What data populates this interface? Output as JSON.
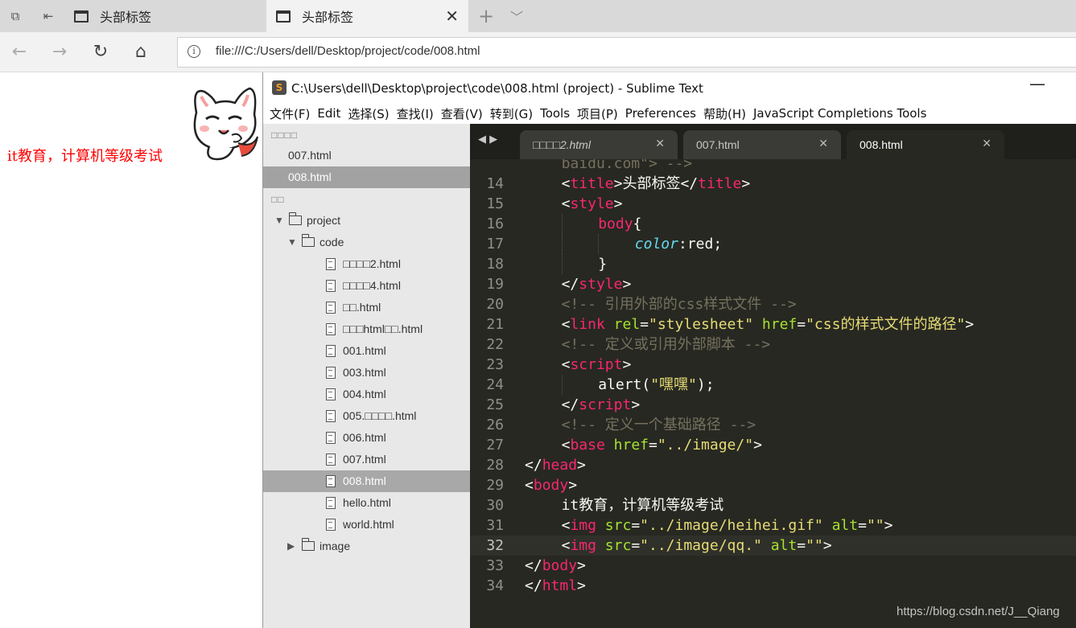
{
  "browser": {
    "tabs": [
      {
        "title": "头部标签",
        "active": false
      },
      {
        "title": "头部标签",
        "active": true
      }
    ],
    "new_tab_icon": "plus-icon",
    "address": "file:///C:/Users/dell/Desktop/project/code/008.html"
  },
  "page": {
    "text": "it教育，计算机等级考试",
    "text_color": "#ff0000",
    "image": "cartoon-cat"
  },
  "sublime": {
    "title": "C:\\Users\\dell\\Desktop\\project\\code\\008.html (project) - Sublime Text",
    "menu": [
      "文件(F)",
      "Edit",
      "选择(S)",
      "查找(I)",
      "查看(V)",
      "转到(G)",
      "Tools",
      "项目(P)",
      "Preferences",
      "帮助(H)",
      "JavaScript Completions Tools"
    ],
    "sidebar": {
      "open_files_header": "□□□□",
      "open_files": [
        "007.html",
        "008.html"
      ],
      "folders_header": "□□",
      "tree": [
        {
          "label": "project",
          "type": "folder",
          "expanded": true,
          "depth": 0
        },
        {
          "label": "code",
          "type": "folder",
          "expanded": true,
          "depth": 1
        },
        {
          "label": "□□□□2.html",
          "type": "file",
          "depth": 2
        },
        {
          "label": "□□□□4.html",
          "type": "file",
          "depth": 2
        },
        {
          "label": "□□.html",
          "type": "file",
          "depth": 2
        },
        {
          "label": "□□□html□□.html",
          "type": "file",
          "depth": 2
        },
        {
          "label": "001.html",
          "type": "file",
          "depth": 2
        },
        {
          "label": "003.html",
          "type": "file",
          "depth": 2
        },
        {
          "label": "004.html",
          "type": "file",
          "depth": 2
        },
        {
          "label": "005.□□□□.html",
          "type": "file",
          "depth": 2
        },
        {
          "label": "006.html",
          "type": "file",
          "depth": 2
        },
        {
          "label": "007.html",
          "type": "file",
          "depth": 2
        },
        {
          "label": "008.html",
          "type": "file",
          "depth": 2,
          "selected": true
        },
        {
          "label": "hello.html",
          "type": "file",
          "depth": 2
        },
        {
          "label": "world.html",
          "type": "file",
          "depth": 2
        },
        {
          "label": "image",
          "type": "folder",
          "expanded": false,
          "depth": 1
        }
      ]
    },
    "editor_tabs": [
      {
        "name": "□□□□2.html",
        "italic": true
      },
      {
        "name": "007.html"
      },
      {
        "name": "008.html",
        "active": true
      }
    ],
    "current_line": 32,
    "code_lines": [
      {
        "n": "",
        "indent": 2,
        "tokens": [
          [
            "cm",
            "baidu.com\"> -->"
          ]
        ]
      },
      {
        "n": "14",
        "indent": 2,
        "tokens": [
          [
            "p",
            "<"
          ],
          [
            "tg",
            "title"
          ],
          [
            "p",
            ">头部标签</"
          ],
          [
            "tg",
            "title"
          ],
          [
            "p",
            ">"
          ]
        ]
      },
      {
        "n": "15",
        "indent": 2,
        "tokens": [
          [
            "p",
            "<"
          ],
          [
            "tg",
            "style"
          ],
          [
            "p",
            ">"
          ]
        ]
      },
      {
        "n": "16",
        "indent": 4,
        "tokens": [
          [
            "tg",
            "body"
          ],
          [
            "p",
            "{"
          ]
        ]
      },
      {
        "n": "17",
        "indent": 6,
        "tokens": [
          [
            "pr",
            "color"
          ],
          [
            "p",
            ":"
          ],
          [
            "p",
            "red"
          ],
          [
            "p",
            ";"
          ]
        ]
      },
      {
        "n": "18",
        "indent": 4,
        "tokens": [
          [
            "p",
            "}"
          ]
        ]
      },
      {
        "n": "19",
        "indent": 2,
        "tokens": [
          [
            "p",
            "</"
          ],
          [
            "tg",
            "style"
          ],
          [
            "p",
            ">"
          ]
        ]
      },
      {
        "n": "20",
        "indent": 2,
        "tokens": [
          [
            "cm",
            "<!-- 引用外部的css样式文件 -->"
          ]
        ]
      },
      {
        "n": "21",
        "indent": 2,
        "tokens": [
          [
            "p",
            "<"
          ],
          [
            "tg",
            "link"
          ],
          [
            "p",
            " "
          ],
          [
            "at",
            "rel"
          ],
          [
            "p",
            "="
          ],
          [
            "st",
            "\"stylesheet\""
          ],
          [
            "p",
            " "
          ],
          [
            "at",
            "href"
          ],
          [
            "p",
            "="
          ],
          [
            "st",
            "\"css的样式文件的路径\""
          ],
          [
            "p",
            ">"
          ]
        ]
      },
      {
        "n": "22",
        "indent": 2,
        "tokens": [
          [
            "cm",
            "<!-- 定义或引用外部脚本 -->"
          ]
        ]
      },
      {
        "n": "23",
        "indent": 2,
        "tokens": [
          [
            "p",
            "<"
          ],
          [
            "tg",
            "script"
          ],
          [
            "p",
            ">"
          ]
        ]
      },
      {
        "n": "24",
        "indent": 4,
        "tokens": [
          [
            "p",
            "alert("
          ],
          [
            "st",
            "\"嘿嘿\""
          ],
          [
            "p",
            ");"
          ]
        ]
      },
      {
        "n": "25",
        "indent": 2,
        "tokens": [
          [
            "p",
            "</"
          ],
          [
            "tg",
            "script"
          ],
          [
            "p",
            ">"
          ]
        ]
      },
      {
        "n": "26",
        "indent": 2,
        "tokens": [
          [
            "cm",
            "<!-- 定义一个基础路径 -->"
          ]
        ]
      },
      {
        "n": "27",
        "indent": 2,
        "tokens": [
          [
            "p",
            "<"
          ],
          [
            "tg",
            "base"
          ],
          [
            "p",
            " "
          ],
          [
            "at",
            "href"
          ],
          [
            "p",
            "="
          ],
          [
            "st",
            "\"../image/\""
          ],
          [
            "p",
            ">"
          ]
        ]
      },
      {
        "n": "28",
        "indent": 0,
        "tokens": [
          [
            "p",
            "</"
          ],
          [
            "tg",
            "head"
          ],
          [
            "p",
            ">"
          ]
        ]
      },
      {
        "n": "29",
        "indent": 0,
        "tokens": [
          [
            "p",
            "<"
          ],
          [
            "tg",
            "body"
          ],
          [
            "p",
            ">"
          ]
        ]
      },
      {
        "n": "30",
        "indent": 2,
        "tokens": [
          [
            "p",
            "it教育，计算机等级考试"
          ]
        ]
      },
      {
        "n": "31",
        "indent": 2,
        "tokens": [
          [
            "p",
            "<"
          ],
          [
            "tg",
            "img"
          ],
          [
            "p",
            " "
          ],
          [
            "at",
            "src"
          ],
          [
            "p",
            "="
          ],
          [
            "st",
            "\"../image/heihei.gif\""
          ],
          [
            "p",
            " "
          ],
          [
            "at",
            "alt"
          ],
          [
            "p",
            "="
          ],
          [
            "st",
            "\"\""
          ],
          [
            "p",
            ">"
          ]
        ]
      },
      {
        "n": "32",
        "indent": 2,
        "tokens": [
          [
            "p",
            "<"
          ],
          [
            "tg",
            "img"
          ],
          [
            "p",
            " "
          ],
          [
            "at",
            "src"
          ],
          [
            "p",
            "="
          ],
          [
            "st",
            "\"../image/qq.\""
          ],
          [
            "p",
            " "
          ],
          [
            "at",
            "alt"
          ],
          [
            "p",
            "="
          ],
          [
            "st",
            "\"\""
          ],
          [
            "p",
            ">"
          ]
        ]
      },
      {
        "n": "33",
        "indent": 0,
        "tokens": [
          [
            "p",
            "</"
          ],
          [
            "tg",
            "body"
          ],
          [
            "p",
            ">"
          ]
        ]
      },
      {
        "n": "34",
        "indent": 0,
        "tokens": [
          [
            "p",
            "</"
          ],
          [
            "tg",
            "html"
          ],
          [
            "p",
            ">"
          ]
        ]
      }
    ]
  },
  "watermark": "https://blog.csdn.net/J__Qiang",
  "colors": {
    "editor_bg": "#272822",
    "tag": "#f92672",
    "attr": "#a6e22e",
    "string": "#e6db74",
    "comment": "#75715e",
    "property": "#66d9ef"
  }
}
